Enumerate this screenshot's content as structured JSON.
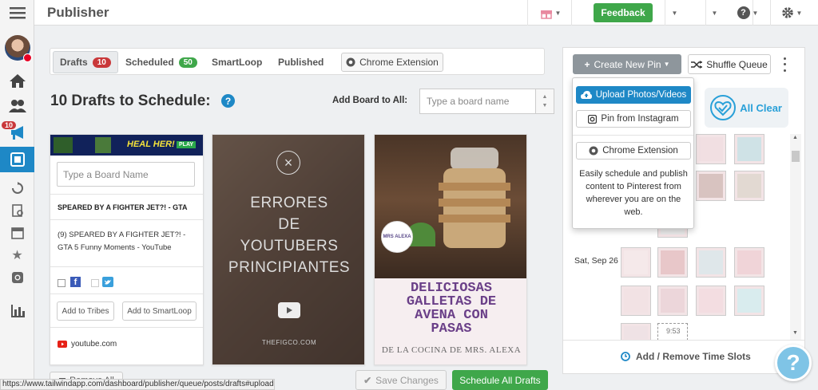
{
  "app": {
    "title": "Publisher"
  },
  "sidebar": {
    "notification_count": "10"
  },
  "topbar": {
    "feedback_label": "Feedback"
  },
  "tabs": [
    {
      "label": "Drafts",
      "badge": "10",
      "badge_color": "#c9383a"
    },
    {
      "label": "Scheduled",
      "badge": "50",
      "badge_color": "#3fa74a"
    },
    {
      "label": "SmartLoop"
    },
    {
      "label": "Published"
    }
  ],
  "chrome_extension_label": "Chrome Extension",
  "drafts": {
    "heading": "10 Drafts to Schedule:",
    "help": "?",
    "add_board_label": "Add Board to All:",
    "board_placeholder": "Type a board name"
  },
  "cards": [
    {
      "banner_text": "HEAL HER!",
      "banner_button": "PLAY",
      "board_placeholder": "Type a Board Name",
      "title": "SPEARED BY A FIGHTER JET?! - GTA",
      "description": "(9) SPEARED BY A FIGHTER JET?! - GTA 5 Funny Moments - YouTube",
      "tribes_label": "Add to Tribes",
      "smartloop_label": "Add to SmartLoop",
      "domain": "youtube.com"
    },
    {
      "lines": [
        "ERRORES",
        "DE",
        "YOUTUBERS",
        "PRINCIPIANTES"
      ],
      "footer": "THEFIGCO.COM"
    },
    {
      "logo_text": "MRS ALEXA",
      "title_lines": [
        "DELICIOSAS",
        "GALLETAS DE",
        "AVENA CON",
        "PASAS"
      ],
      "subtitle": "DE LA COCINA DE MRS. ALEXA"
    }
  ],
  "footer": {
    "remove_all": "Remove All",
    "save_changes": "Save Changes",
    "schedule_all": "Schedule All Drafts",
    "status_url": "https://www.tailwindapp.com/dashboard/publisher/queue/posts/drafts#upload"
  },
  "queue": {
    "create_pin": "Create New Pin",
    "shuffle": "Shuffle Queue",
    "all_clear": "All Clear",
    "day_label": "Sat, Sep 26",
    "time_label": "9:53",
    "time_slots": "Add / Remove Time Slots"
  },
  "dropdown": {
    "upload": "Upload Photos/Videos",
    "instagram": "Pin from Instagram",
    "chrome": "Chrome Extension",
    "description": "Easily schedule and publish content to Pinterest from wherever you are on the web."
  },
  "help_fab": "?"
}
